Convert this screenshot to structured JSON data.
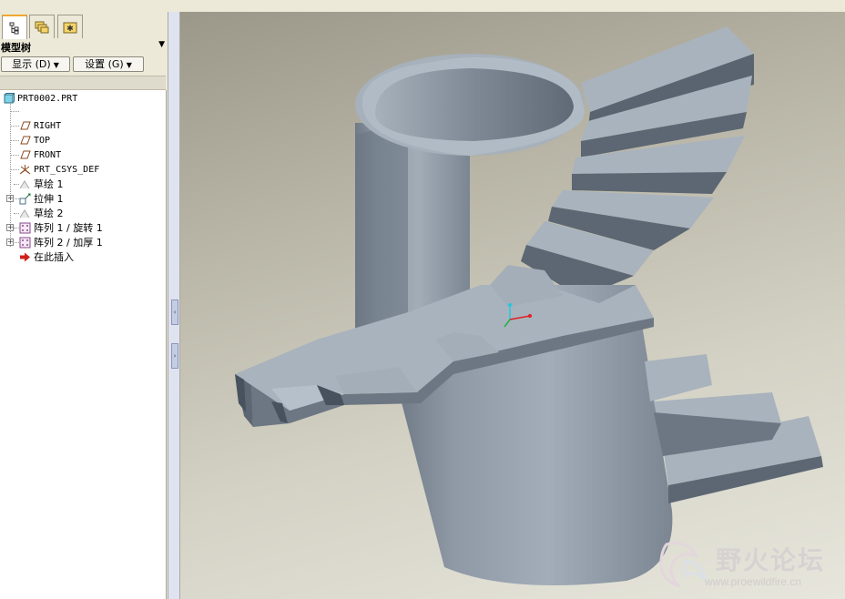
{
  "model_tree": {
    "title": "模型树",
    "menu_arrow": "▼",
    "show_button": "显示 (D)",
    "settings_button": "设置 (G)",
    "items": [
      {
        "label": "PRT0002.PRT",
        "icon": "part-icon"
      },
      {
        "label": "RIGHT",
        "icon": "datum-plane-icon"
      },
      {
        "label": "TOP",
        "icon": "datum-plane-icon"
      },
      {
        "label": "FRONT",
        "icon": "datum-plane-icon"
      },
      {
        "label": "PRT_CSYS_DEF",
        "icon": "csys-icon"
      },
      {
        "label": "草绘 1",
        "icon": "sketch-icon"
      },
      {
        "label": "拉伸 1",
        "icon": "extrude-icon"
      },
      {
        "label": "草绘 2",
        "icon": "sketch-icon"
      },
      {
        "label": "阵列 1 / 旋转 1",
        "icon": "pattern-icon"
      },
      {
        "label": "阵列 2 / 加厚 1",
        "icon": "pattern-icon"
      },
      {
        "label": "在此插入",
        "icon": "insert-here-arrow-icon"
      }
    ]
  },
  "tabs": [
    {
      "name": "model-tree-tab",
      "icon": "tree-icon",
      "active": true
    },
    {
      "name": "folder-browser-tab",
      "icon": "folders-icon",
      "active": false
    },
    {
      "name": "favorites-tab",
      "icon": "favorites-icon",
      "active": false
    }
  ],
  "watermark": {
    "title": "野火论坛",
    "url": "www.proewildfire.cn"
  },
  "colors": {
    "model_surface": "#8f9aa6",
    "viewport_top": "#9b9889",
    "viewport_bottom": "#e7e6dc",
    "tab_accent": "#f0a830"
  }
}
